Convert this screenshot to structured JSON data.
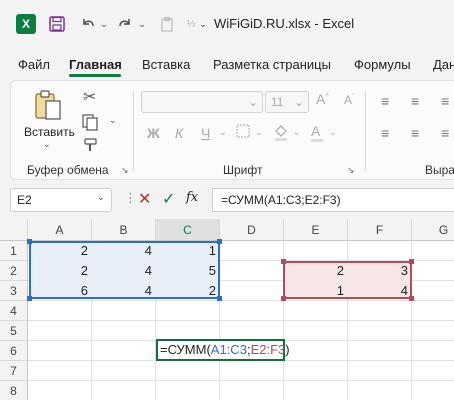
{
  "title": "WiFiGiD.RU.xlsx  -  Excel",
  "tabs": [
    "Файл",
    "Главная",
    "Вставка",
    "Разметка страницы",
    "Формулы",
    "Дан"
  ],
  "ribbon": {
    "paste_label": "Вставить",
    "groups": [
      "Буфер обмена",
      "Шрифт",
      "Выра"
    ],
    "font_size": "11",
    "bold": "Ж",
    "italic": "К",
    "underline": "Ч"
  },
  "formula_bar": {
    "name_box": "E2",
    "fx": "fx",
    "formula": "=СУММ(A1:C3;E2:F3)"
  },
  "columns": [
    "A",
    "B",
    "C",
    "D",
    "E",
    "F",
    "G"
  ],
  "rows": [
    "1",
    "2",
    "3",
    "4",
    "5",
    "6",
    "7",
    "8"
  ],
  "cells": {
    "A1": "2",
    "B1": "4",
    "C1": "1",
    "A2": "2",
    "B2": "4",
    "C2": "5",
    "A3": "6",
    "B3": "4",
    "C3": "2",
    "E2": "2",
    "F2": "3",
    "E3": "1",
    "F3": "4"
  },
  "editing": {
    "prefix": "=СУММ(",
    "ref1": "A1:C3",
    "sep": ";",
    "ref2": "E2:F3",
    "suffix": ")"
  },
  "colors": {
    "accent": "#107c41",
    "range1": "#2f6fc1",
    "range2": "#b14c5a"
  }
}
